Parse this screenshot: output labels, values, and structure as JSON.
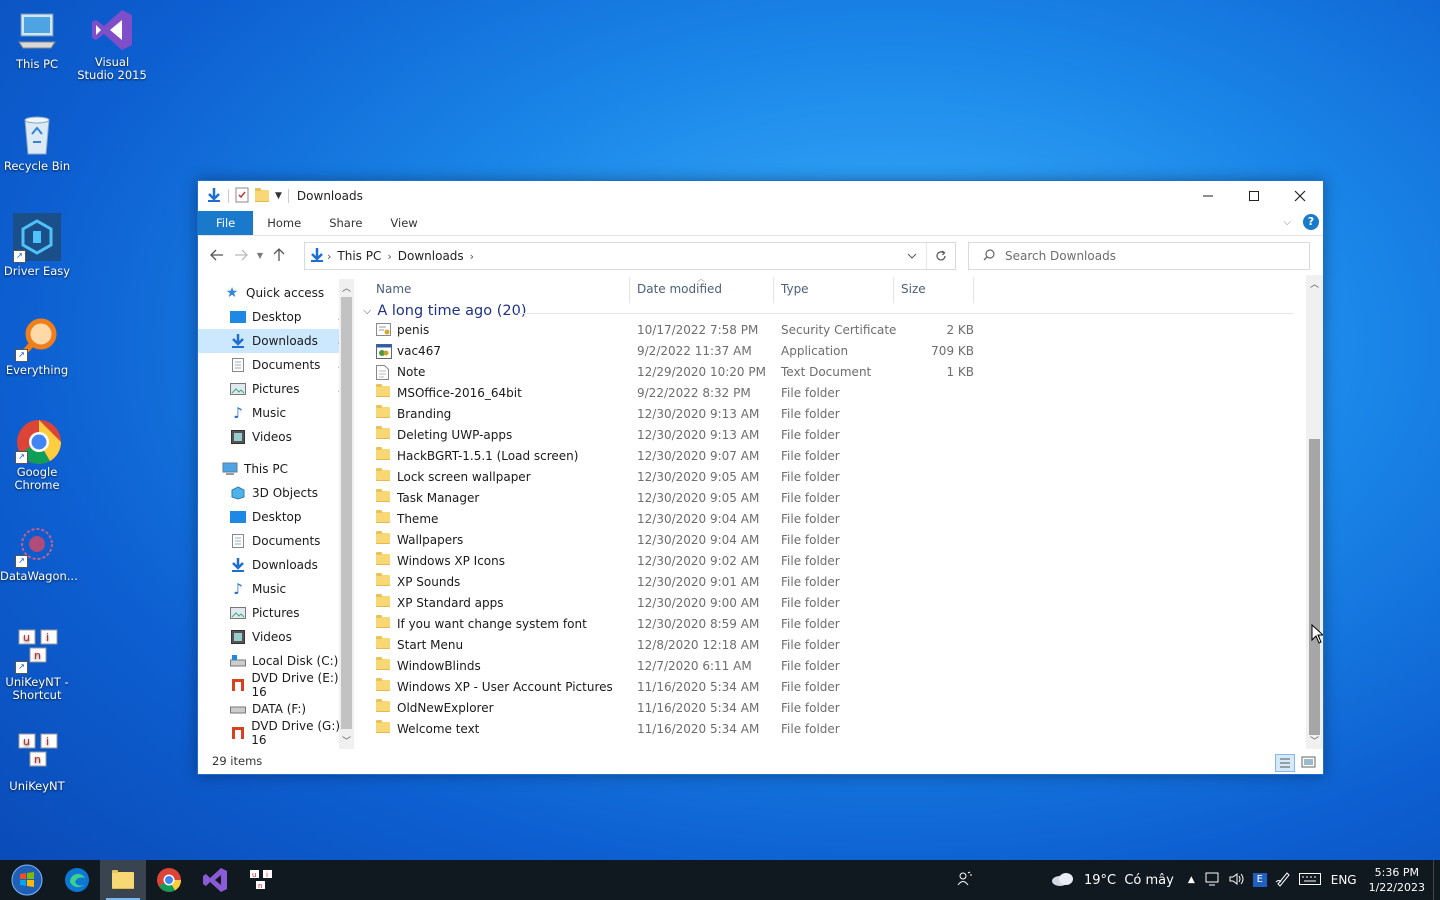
{
  "desktop": {
    "icons": [
      {
        "label": "This PC"
      },
      {
        "label": "Visual Studio 2015"
      },
      {
        "label": "Recycle Bin"
      },
      {
        "label": "Driver Easy"
      },
      {
        "label": "Everything"
      },
      {
        "label": "Google Chrome"
      },
      {
        "label": "DataWagon..."
      },
      {
        "label": "UniKeyNT - Shortcut"
      },
      {
        "label": "UniKeyNT"
      }
    ]
  },
  "window": {
    "title": "Downloads",
    "ribbon": {
      "file": "File",
      "home": "Home",
      "share": "Share",
      "view": "View"
    },
    "address": {
      "crumbs": [
        "This PC",
        "Downloads"
      ]
    },
    "search": {
      "placeholder": "Search Downloads"
    },
    "nav": {
      "quick_access": "Quick access",
      "qa_items": [
        "Desktop",
        "Downloads",
        "Documents",
        "Pictures",
        "Music",
        "Videos"
      ],
      "this_pc": "This PC",
      "pc_items": [
        "3D Objects",
        "Desktop",
        "Documents",
        "Downloads",
        "Music",
        "Pictures",
        "Videos",
        "Local Disk (C:)",
        "DVD Drive (E:) 16",
        "DATA (F:)",
        "DVD Drive (G:) 16"
      ]
    },
    "columns": {
      "name": "Name",
      "date": "Date modified",
      "type": "Type",
      "size": "Size"
    },
    "group": "A long time ago (20)",
    "files": [
      {
        "name": "penis",
        "date": "10/17/2022 7:58 PM",
        "type": "Security Certificate",
        "size": "2 KB",
        "icon": "certificate"
      },
      {
        "name": "vac467",
        "date": "9/2/2022 11:37 AM",
        "type": "Application",
        "size": "709 KB",
        "icon": "application"
      },
      {
        "name": "Note",
        "date": "12/29/2020 10:20 PM",
        "type": "Text Document",
        "size": "1 KB",
        "icon": "text"
      },
      {
        "name": "MSOffice-2016_64bit",
        "date": "9/22/2022 8:32 PM",
        "type": "File folder",
        "size": "",
        "icon": "folder"
      },
      {
        "name": "Branding",
        "date": "12/30/2020 9:13 AM",
        "type": "File folder",
        "size": "",
        "icon": "folder"
      },
      {
        "name": "Deleting UWP-apps",
        "date": "12/30/2020 9:13 AM",
        "type": "File folder",
        "size": "",
        "icon": "folder"
      },
      {
        "name": "HackBGRT-1.5.1 (Load screen)",
        "date": "12/30/2020 9:07 AM",
        "type": "File folder",
        "size": "",
        "icon": "folder"
      },
      {
        "name": "Lock screen wallpaper",
        "date": "12/30/2020 9:05 AM",
        "type": "File folder",
        "size": "",
        "icon": "folder"
      },
      {
        "name": "Task Manager",
        "date": "12/30/2020 9:05 AM",
        "type": "File folder",
        "size": "",
        "icon": "folder"
      },
      {
        "name": "Theme",
        "date": "12/30/2020 9:04 AM",
        "type": "File folder",
        "size": "",
        "icon": "folder"
      },
      {
        "name": "Wallpapers",
        "date": "12/30/2020 9:04 AM",
        "type": "File folder",
        "size": "",
        "icon": "folder"
      },
      {
        "name": "Windows XP Icons",
        "date": "12/30/2020 9:02 AM",
        "type": "File folder",
        "size": "",
        "icon": "folder"
      },
      {
        "name": "XP Sounds",
        "date": "12/30/2020 9:01 AM",
        "type": "File folder",
        "size": "",
        "icon": "folder"
      },
      {
        "name": "XP Standard apps",
        "date": "12/30/2020 9:00 AM",
        "type": "File folder",
        "size": "",
        "icon": "folder"
      },
      {
        "name": "If you want change system font",
        "date": "12/30/2020 8:59 AM",
        "type": "File folder",
        "size": "",
        "icon": "folder"
      },
      {
        "name": "Start Menu",
        "date": "12/8/2020 12:18 AM",
        "type": "File folder",
        "size": "",
        "icon": "folder"
      },
      {
        "name": "WindowBlinds",
        "date": "12/7/2020 6:11 AM",
        "type": "File folder",
        "size": "",
        "icon": "folder"
      },
      {
        "name": "Windows XP - User Account Pictures",
        "date": "11/16/2020 5:34 AM",
        "type": "File folder",
        "size": "",
        "icon": "folder"
      },
      {
        "name": "OldNewExplorer",
        "date": "11/16/2020 5:34 AM",
        "type": "File folder",
        "size": "",
        "icon": "folder"
      },
      {
        "name": "Welcome text",
        "date": "11/16/2020 5:34 AM",
        "type": "File folder",
        "size": "",
        "icon": "folder"
      }
    ],
    "status": "29 items"
  },
  "taskbar": {
    "weather": "19°C  Có mây",
    "lang": "ENG",
    "time": "5:36 PM",
    "date": "1/22/2023"
  },
  "colors": {
    "accent": "#1979ca",
    "selection": "#cce8ff",
    "taskbar": "#101820"
  }
}
